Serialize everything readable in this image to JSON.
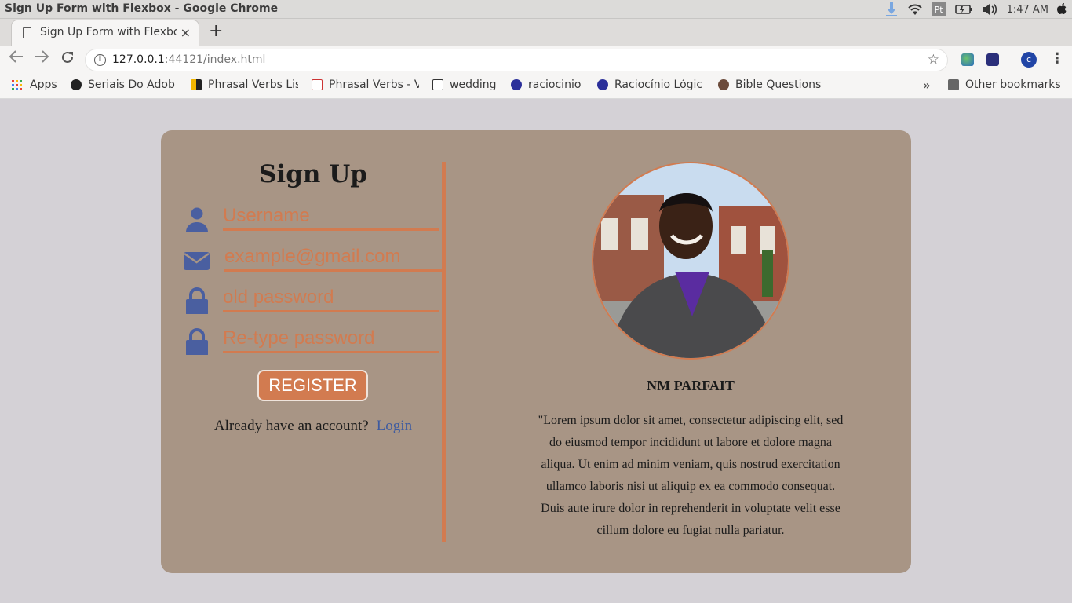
{
  "os": {
    "window_title": "Sign Up Form with Flexbox - Google Chrome",
    "tray_pt": "Pt",
    "clock": "1:47 AM"
  },
  "browser": {
    "tab_title": "Sign Up Form with Flexbox",
    "tab_close": "×",
    "new_tab": "+",
    "url_host": "127.0.0.1",
    "url_rest": ":44121/index.html",
    "profile_initial": "c"
  },
  "bookmarks": {
    "apps": "Apps",
    "items": [
      {
        "label": "Seriais Do Adob"
      },
      {
        "label": "Phrasal Verbs Lis"
      },
      {
        "label": "Phrasal Verbs - V"
      },
      {
        "label": "wedding"
      },
      {
        "label": "raciocinio"
      },
      {
        "label": "Raciocínio Lógic"
      },
      {
        "label": "Bible Questions"
      }
    ],
    "more": "»",
    "other": "Other bookmarks"
  },
  "signup": {
    "title": "Sign Up",
    "username_placeholder": "Username",
    "email_placeholder": "example@gmail.com",
    "old_password_placeholder": "old password",
    "retype_password_placeholder": "Re-type password",
    "register_label": "REGISTER",
    "account_prompt": "Already have an account?",
    "login_label": "Login"
  },
  "profile": {
    "name": "NM PARFAIT",
    "quote": "\"Lorem ipsum dolor sit amet, consectetur adipiscing elit, sed do eiusmod tempor incididunt ut labore et dolore magna aliqua. Ut enim ad minim veniam, quis nostrud exercitation ullamco laboris nisi ut aliquip ex ea commodo consequat. Duis aute irure dolor in reprehenderit in voluptate velit esse cillum dolore eu fugiat nulla pariatur."
  },
  "colors": {
    "page_bg": "#d4d1d6",
    "card_bg": "#a89585",
    "accent": "#d27b50",
    "icon": "#4a5fa0",
    "link": "#3e5ba0"
  },
  "icons": [
    "user-icon",
    "envelope-icon",
    "lock-icon",
    "lock-icon"
  ]
}
